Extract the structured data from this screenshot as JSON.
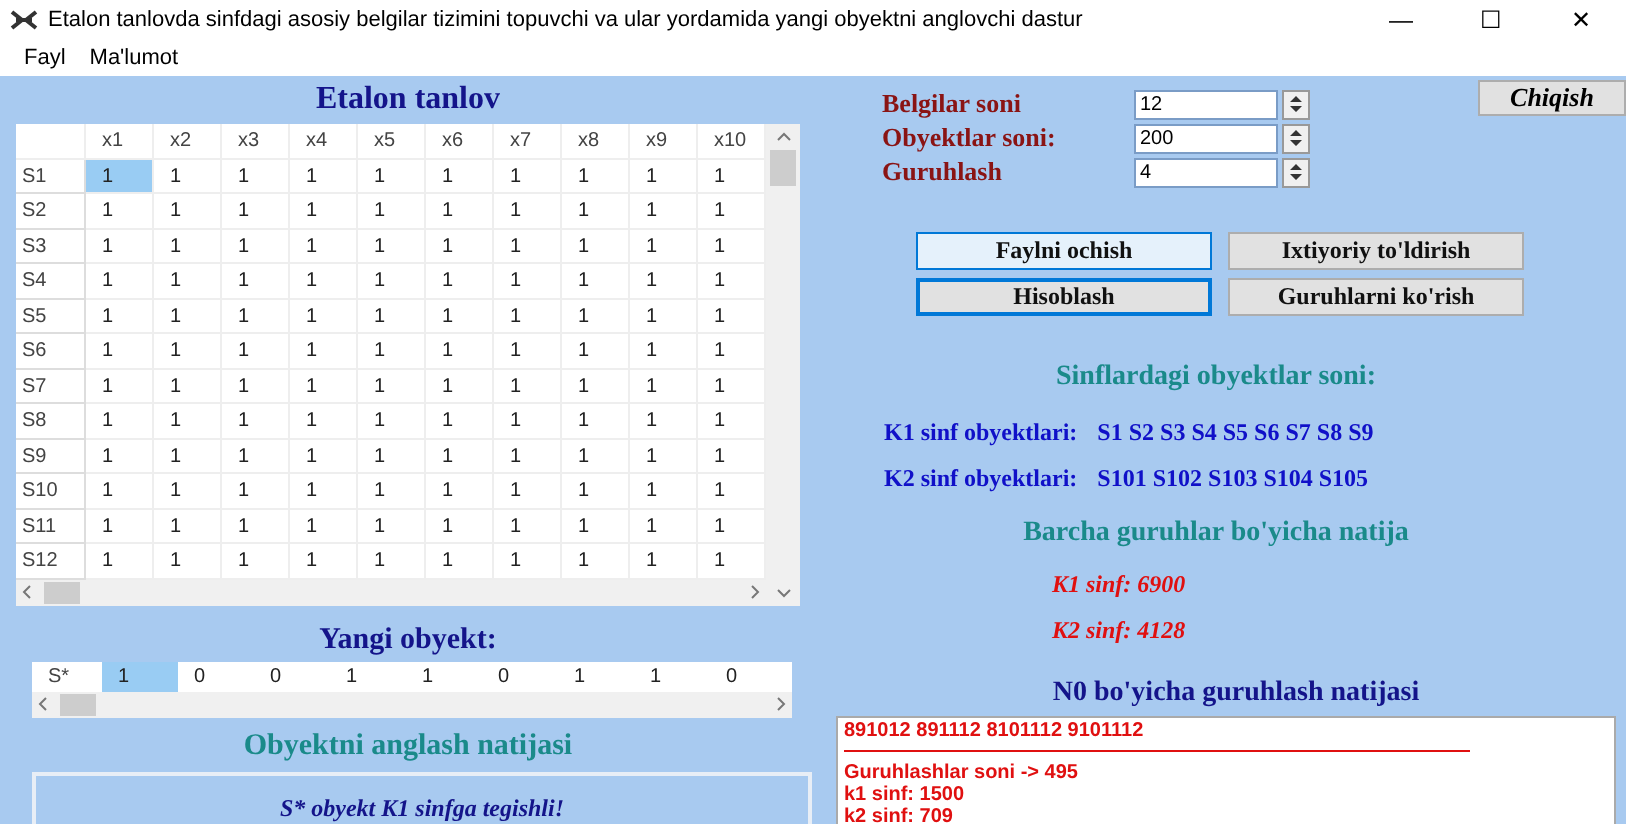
{
  "window": {
    "title": "Etalon tanlovda sinfdagi asosiy belgilar tizimini topuvchi va ular yordamida yangi obyektni anglovchi dastur",
    "controls": [
      "—",
      "☐",
      "✕"
    ]
  },
  "menu": [
    "Fayl",
    "Ma'lumot"
  ],
  "etalon": {
    "title": "Etalon tanlov",
    "columns": [
      "x1",
      "x2",
      "x3",
      "x4",
      "x5",
      "x6",
      "x7",
      "x8",
      "x9",
      "x10"
    ],
    "rows": [
      {
        "label": "S1",
        "cells": [
          {
            "value": "1",
            "selected": true
          },
          {
            "value": "1",
            "selected": false
          },
          {
            "value": "1",
            "selected": false
          },
          {
            "value": "1",
            "selected": false
          },
          {
            "value": "1",
            "selected": false
          },
          {
            "value": "1",
            "selected": false
          },
          {
            "value": "1",
            "selected": false
          },
          {
            "value": "1",
            "selected": false
          },
          {
            "value": "1",
            "selected": false
          },
          {
            "value": "1",
            "selected": false
          }
        ]
      },
      {
        "label": "S2",
        "cells": [
          {
            "value": "1",
            "selected": false
          },
          {
            "value": "1",
            "selected": false
          },
          {
            "value": "1",
            "selected": false
          },
          {
            "value": "1",
            "selected": false
          },
          {
            "value": "1",
            "selected": false
          },
          {
            "value": "1",
            "selected": false
          },
          {
            "value": "1",
            "selected": false
          },
          {
            "value": "1",
            "selected": false
          },
          {
            "value": "1",
            "selected": false
          },
          {
            "value": "1",
            "selected": false
          }
        ]
      },
      {
        "label": "S3",
        "cells": [
          {
            "value": "1",
            "selected": false
          },
          {
            "value": "1",
            "selected": false
          },
          {
            "value": "1",
            "selected": false
          },
          {
            "value": "1",
            "selected": false
          },
          {
            "value": "1",
            "selected": false
          },
          {
            "value": "1",
            "selected": false
          },
          {
            "value": "1",
            "selected": false
          },
          {
            "value": "1",
            "selected": false
          },
          {
            "value": "1",
            "selected": false
          },
          {
            "value": "1",
            "selected": false
          }
        ]
      },
      {
        "label": "S4",
        "cells": [
          {
            "value": "1",
            "selected": false
          },
          {
            "value": "1",
            "selected": false
          },
          {
            "value": "1",
            "selected": false
          },
          {
            "value": "1",
            "selected": false
          },
          {
            "value": "1",
            "selected": false
          },
          {
            "value": "1",
            "selected": false
          },
          {
            "value": "1",
            "selected": false
          },
          {
            "value": "1",
            "selected": false
          },
          {
            "value": "1",
            "selected": false
          },
          {
            "value": "1",
            "selected": false
          }
        ]
      },
      {
        "label": "S5",
        "cells": [
          {
            "value": "1",
            "selected": false
          },
          {
            "value": "1",
            "selected": false
          },
          {
            "value": "1",
            "selected": false
          },
          {
            "value": "1",
            "selected": false
          },
          {
            "value": "1",
            "selected": false
          },
          {
            "value": "1",
            "selected": false
          },
          {
            "value": "1",
            "selected": false
          },
          {
            "value": "1",
            "selected": false
          },
          {
            "value": "1",
            "selected": false
          },
          {
            "value": "1",
            "selected": false
          }
        ]
      },
      {
        "label": "S6",
        "cells": [
          {
            "value": "1",
            "selected": false
          },
          {
            "value": "1",
            "selected": false
          },
          {
            "value": "1",
            "selected": false
          },
          {
            "value": "1",
            "selected": false
          },
          {
            "value": "1",
            "selected": false
          },
          {
            "value": "1",
            "selected": false
          },
          {
            "value": "1",
            "selected": false
          },
          {
            "value": "1",
            "selected": false
          },
          {
            "value": "1",
            "selected": false
          },
          {
            "value": "1",
            "selected": false
          }
        ]
      },
      {
        "label": "S7",
        "cells": [
          {
            "value": "1",
            "selected": false
          },
          {
            "value": "1",
            "selected": false
          },
          {
            "value": "1",
            "selected": false
          },
          {
            "value": "1",
            "selected": false
          },
          {
            "value": "1",
            "selected": false
          },
          {
            "value": "1",
            "selected": false
          },
          {
            "value": "1",
            "selected": false
          },
          {
            "value": "1",
            "selected": false
          },
          {
            "value": "1",
            "selected": false
          },
          {
            "value": "1",
            "selected": false
          }
        ]
      },
      {
        "label": "S8",
        "cells": [
          {
            "value": "1",
            "selected": false
          },
          {
            "value": "1",
            "selected": false
          },
          {
            "value": "1",
            "selected": false
          },
          {
            "value": "1",
            "selected": false
          },
          {
            "value": "1",
            "selected": false
          },
          {
            "value": "1",
            "selected": false
          },
          {
            "value": "1",
            "selected": false
          },
          {
            "value": "1",
            "selected": false
          },
          {
            "value": "1",
            "selected": false
          },
          {
            "value": "1",
            "selected": false
          }
        ]
      },
      {
        "label": "S9",
        "cells": [
          {
            "value": "1",
            "selected": false
          },
          {
            "value": "1",
            "selected": false
          },
          {
            "value": "1",
            "selected": false
          },
          {
            "value": "1",
            "selected": false
          },
          {
            "value": "1",
            "selected": false
          },
          {
            "value": "1",
            "selected": false
          },
          {
            "value": "1",
            "selected": false
          },
          {
            "value": "1",
            "selected": false
          },
          {
            "value": "1",
            "selected": false
          },
          {
            "value": "1",
            "selected": false
          }
        ]
      },
      {
        "label": "S10",
        "cells": [
          {
            "value": "1",
            "selected": false
          },
          {
            "value": "1",
            "selected": false
          },
          {
            "value": "1",
            "selected": false
          },
          {
            "value": "1",
            "selected": false
          },
          {
            "value": "1",
            "selected": false
          },
          {
            "value": "1",
            "selected": false
          },
          {
            "value": "1",
            "selected": false
          },
          {
            "value": "1",
            "selected": false
          },
          {
            "value": "1",
            "selected": false
          },
          {
            "value": "1",
            "selected": false
          }
        ]
      },
      {
        "label": "S11",
        "cells": [
          {
            "value": "1",
            "selected": false
          },
          {
            "value": "1",
            "selected": false
          },
          {
            "value": "1",
            "selected": false
          },
          {
            "value": "1",
            "selected": false
          },
          {
            "value": "1",
            "selected": false
          },
          {
            "value": "1",
            "selected": false
          },
          {
            "value": "1",
            "selected": false
          },
          {
            "value": "1",
            "selected": false
          },
          {
            "value": "1",
            "selected": false
          },
          {
            "value": "1",
            "selected": false
          }
        ]
      },
      {
        "label": "S12",
        "cells": [
          {
            "value": "1",
            "selected": false
          },
          {
            "value": "1",
            "selected": false
          },
          {
            "value": "1",
            "selected": false
          },
          {
            "value": "1",
            "selected": false
          },
          {
            "value": "1",
            "selected": false
          },
          {
            "value": "1",
            "selected": false
          },
          {
            "value": "1",
            "selected": false
          },
          {
            "value": "1",
            "selected": false
          },
          {
            "value": "1",
            "selected": false
          },
          {
            "value": "1",
            "selected": false
          }
        ]
      }
    ]
  },
  "new_object": {
    "title": "Yangi obyekt:",
    "label": "S*",
    "cells": [
      {
        "value": "1",
        "selected": true
      },
      {
        "value": "0",
        "selected": false
      },
      {
        "value": "0",
        "selected": false
      },
      {
        "value": "1",
        "selected": false
      },
      {
        "value": "1",
        "selected": false
      },
      {
        "value": "0",
        "selected": false
      },
      {
        "value": "1",
        "selected": false
      },
      {
        "value": "1",
        "selected": false
      },
      {
        "value": "0",
        "selected": false
      }
    ]
  },
  "recognition": {
    "title": "Obyektni anglash natijasi",
    "result": "S* obyekt K1 sinfga tegishli!"
  },
  "fields": [
    {
      "label": "Belgilar soni",
      "value": "12"
    },
    {
      "label": "Obyektlar soni:",
      "value": "200"
    },
    {
      "label": "Guruhlash",
      "value": "4"
    }
  ],
  "exit_button": "Chiqish",
  "buttons": [
    {
      "label": "Faylni ochish",
      "highlighted": true,
      "focused": false
    },
    {
      "label": "Ixtiyoriy to'ldirish",
      "highlighted": false,
      "focused": false
    },
    {
      "label": "Hisoblash",
      "highlighted": false,
      "focused": true
    },
    {
      "label": "Guruhlarni ko'rish",
      "highlighted": false,
      "focused": false
    }
  ],
  "classes": {
    "title": "Sinflardagi obyektlar soni:",
    "rows": [
      {
        "label": "K1 sinf obyektlari:",
        "value": "S1 S2 S3 S4 S5 S6 S7 S8 S9"
      },
      {
        "label": "K2 sinf obyektlari:",
        "value": "S101 S102 S103 S104 S105"
      }
    ]
  },
  "all_groups": {
    "title": "Barcha guruhlar bo'yicha natija",
    "results": [
      "K1 sinf: 6900",
      "K2 sinf: 4128"
    ]
  },
  "n0": {
    "title": "N0 bo'yicha guruhlash natijasi",
    "first_line": "891012 891112 8101112 9101112",
    "lines": [
      "Guruhlashlar soni -> 495",
      "k1 sinf: 1500",
      "k2 sinf: 709"
    ]
  }
}
